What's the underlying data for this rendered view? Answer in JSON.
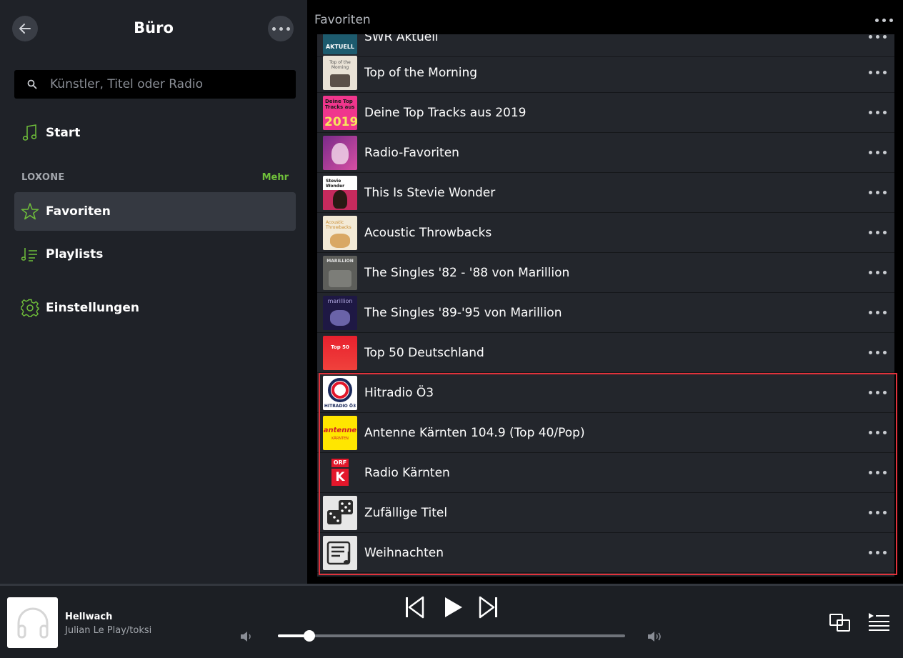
{
  "sidebar": {
    "title": "Büro",
    "search_placeholder": "Künstler, Titel oder Radio",
    "nav": {
      "start": "Start",
      "section": "LOXONE",
      "section_more": "Mehr",
      "favorites": "Favoriten",
      "playlists": "Playlists",
      "settings": "Einstellungen"
    }
  },
  "main": {
    "title": "Favoriten",
    "items": [
      {
        "label": "SWR Aktuell"
      },
      {
        "label": "Top of the Morning"
      },
      {
        "label": "Deine Top Tracks aus 2019"
      },
      {
        "label": "Radio-Favoriten"
      },
      {
        "label": "This Is Stevie Wonder"
      },
      {
        "label": "Acoustic Throwbacks"
      },
      {
        "label": "The Singles '82 - '88 von Marillion"
      },
      {
        "label": "The Singles '89-'95 von Marillion"
      },
      {
        "label": "Top 50 Deutschland"
      },
      {
        "label": "Hitradio Ö3"
      },
      {
        "label": "Antenne Kärnten 104.9 (Top 40/Pop)"
      },
      {
        "label": "Radio Kärnten"
      },
      {
        "label": "Zufällige Titel"
      },
      {
        "label": "Weihnachten"
      }
    ],
    "thumb_text": {
      "swr": "AKTUELL",
      "morning": "Top of the Morning",
      "toptracks_top": "Deine Top Tracks aus",
      "toptracks_year": "2019",
      "stevie": "Stevie Wonder",
      "acoustic": "Acoustic Throwbacks",
      "marillion1": "MARILLION",
      "marillion2": "marillion",
      "top50": "Top 50",
      "hitradio": "HITRADIO Ö3",
      "antenne": "antenne",
      "antenne_sub": "KÄRNTEN",
      "orf": "ORF",
      "orf_k": "K"
    }
  },
  "player": {
    "title": "Hellwach",
    "artist": "Julian Le Play/toksi",
    "volume_fraction": 0.09
  },
  "colors": {
    "accent": "#6fbf3a",
    "highlight": "#e0323b"
  }
}
